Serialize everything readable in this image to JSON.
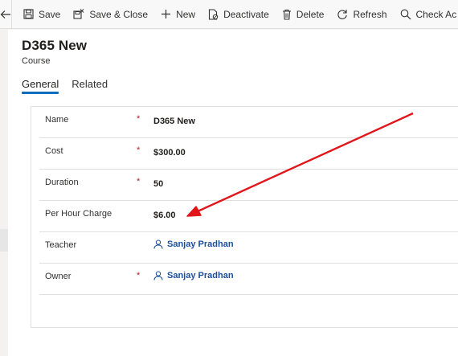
{
  "toolbar": {
    "save_label": "Save",
    "save_close_label": "Save & Close",
    "new_label": "New",
    "deactivate_label": "Deactivate",
    "delete_label": "Delete",
    "refresh_label": "Refresh",
    "check_access_label": "Check Ac"
  },
  "record": {
    "title": "D365 New",
    "entity": "Course"
  },
  "tabs": [
    {
      "label": "General",
      "active": true
    },
    {
      "label": "Related",
      "active": false
    }
  ],
  "fields": [
    {
      "label": "Name",
      "required": "*",
      "value": "D365 New"
    },
    {
      "label": "Cost",
      "required": "*",
      "value": "$300.00"
    },
    {
      "label": "Duration",
      "required": "*",
      "value": "50"
    },
    {
      "label": "Per Hour Charge",
      "required": "",
      "value": "$6.00"
    },
    {
      "label": "Teacher",
      "required": "",
      "value": "Sanjay Pradhan"
    },
    {
      "label": "Owner",
      "required": "*",
      "value": "Sanjay Pradhan"
    }
  ],
  "colors": {
    "accent": "#0f6cbd",
    "required": "#a4262c",
    "lookup": "#1b4f9c",
    "annotation_arrow": "#e0161b"
  }
}
